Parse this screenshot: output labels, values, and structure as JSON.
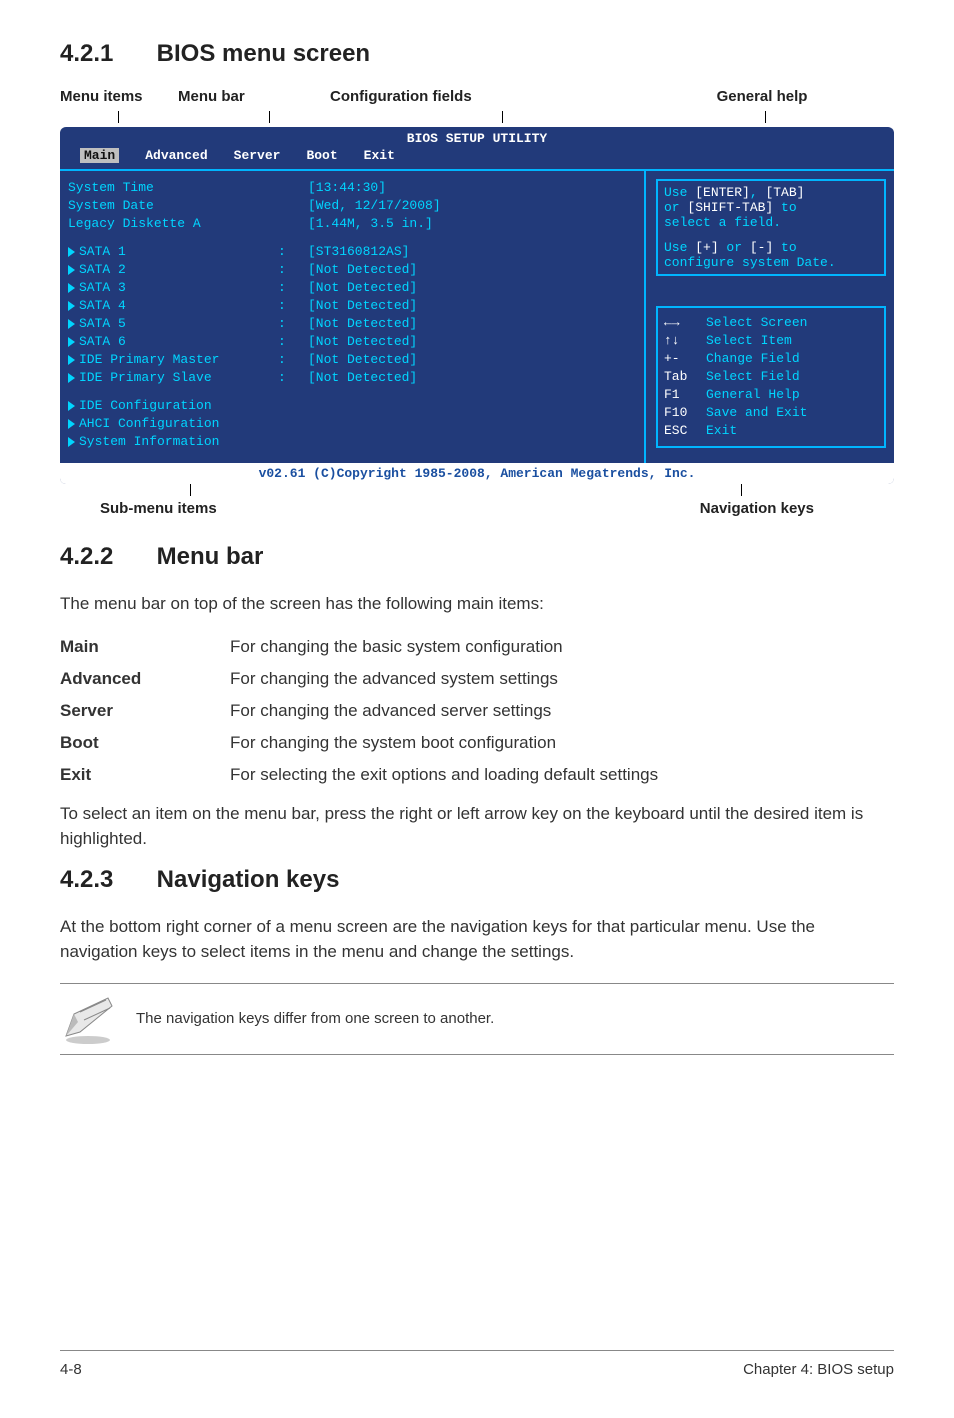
{
  "sections": {
    "s1": {
      "num": "4.2.1",
      "title": "BIOS menu screen"
    },
    "s2": {
      "num": "4.2.2",
      "title": "Menu bar"
    },
    "s3": {
      "num": "4.2.3",
      "title": "Navigation keys"
    }
  },
  "img_labels": {
    "menu_items": "Menu items",
    "menu_bar": "Menu bar",
    "config_fields": "Configuration fields",
    "general_help": "General help",
    "sub_menu": "Sub-menu items",
    "nav_keys": "Navigation keys"
  },
  "bios": {
    "title": "BIOS SETUP UTILITY",
    "tabs": {
      "main": "Main",
      "advanced": "Advanced",
      "server": "Server",
      "boot": "Boot",
      "exit": "Exit"
    },
    "left_labels": {
      "system_time": "System Time",
      "system_date": "System Date",
      "legacy": "Legacy Diskette A",
      "sata1": "SATA 1",
      "sata2": "SATA 2",
      "sata3": "SATA 3",
      "sata4": "SATA 4",
      "sata5": "SATA 5",
      "sata6": "SATA 6",
      "ide_pm": "IDE Primary Master",
      "ide_ps": "IDE Primary Slave",
      "ide_cfg": "IDE Configuration",
      "ahci_cfg": "AHCI Configuration",
      "sys_info": "System Information"
    },
    "values": {
      "time": "[13:44:30]",
      "date": "[Wed, 12/17/2008]",
      "legacy": "[1.44M, 3.5 in.]",
      "sata1": "[ST3160812AS]",
      "nd": "[Not Detected]"
    },
    "help": {
      "line1a": "Use ",
      "line1b": "[ENTER]",
      "line1c": ", ",
      "line1d": "[TAB]",
      "line2a": "or ",
      "line2b": "[SHIFT-TAB]",
      "line2c": " to",
      "line3": "select a field.",
      "line4a": "Use ",
      "line4b": "[+]",
      "line4c": " or ",
      "line4d": "[-]",
      "line4e": " to",
      "line5": "configure system Date."
    },
    "nav": {
      "k1": "←→",
      "d1": "Select Screen",
      "k2": "↑↓",
      "d2": "Select Item",
      "k3": "+-",
      "d3": "Change Field",
      "k4": "Tab",
      "d4": "Select Field",
      "k5": "F1",
      "d5": "General Help",
      "k6": "F10",
      "d6": "Save and Exit",
      "k7": "ESC",
      "d7": "Exit"
    },
    "footer": "v02.61 (C)Copyright 1985-2008, American Megatrends, Inc."
  },
  "p_menubar_intro": "The menu bar on top of the screen has the following main items:",
  "defs": {
    "main_t": "Main",
    "main_d": "For changing the basic system configuration",
    "adv_t": "Advanced",
    "adv_d": "For changing the advanced system settings",
    "srv_t": "Server",
    "srv_d": "For changing the advanced server settings",
    "boot_t": "Boot",
    "boot_d": "For changing the system boot configuration",
    "exit_t": "Exit",
    "exit_d": "For selecting the exit options and loading default settings"
  },
  "p_select": "To select an item on the menu bar, press the right or left arrow key on the keyboard until the desired item is highlighted.",
  "p_navkeys": "At the bottom right corner of a menu screen are the navigation keys for that particular menu. Use the navigation keys to select items in the menu and change the settings.",
  "note": "The navigation keys differ from one screen to another.",
  "footer": {
    "page": "4-8",
    "chapter": "Chapter 4: BIOS setup"
  }
}
